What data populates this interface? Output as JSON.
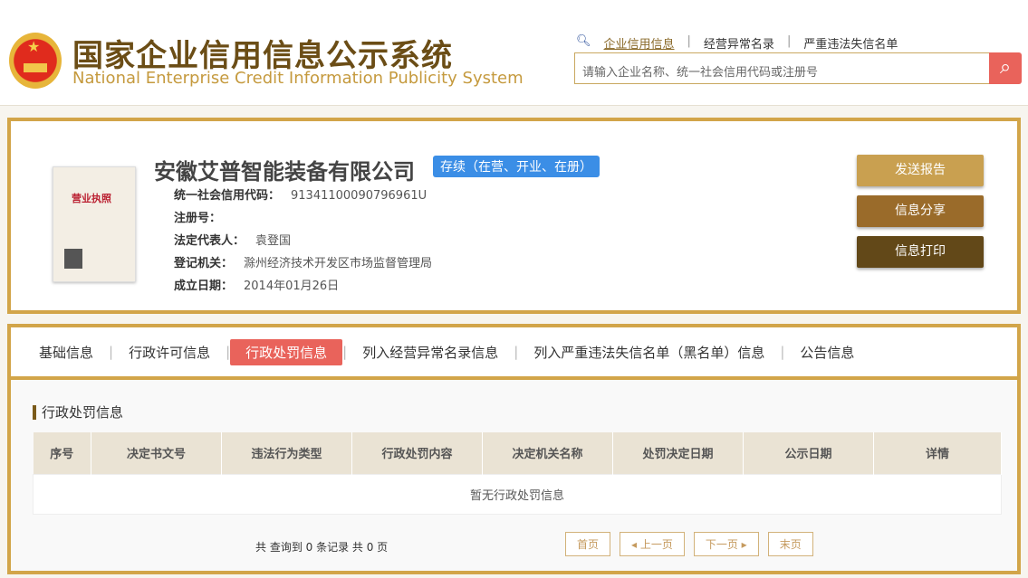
{
  "header": {
    "title_cn": "国家企业信用信息公示系统",
    "title_en": "National Enterprise Credit Information Publicity System",
    "links": [
      "企业信用信息",
      "经营异常名录",
      "严重违法失信名单"
    ],
    "search_placeholder": "请输入企业名称、统一社会信用代码或注册号"
  },
  "company": {
    "license_title": "营业执照",
    "name": "安徽艾普智能装备有限公司",
    "status": "存续（在营、开业、在册）",
    "fields": [
      {
        "label": "统一社会信用代码：",
        "value": "91341100090796961U"
      },
      {
        "label": "注册号：",
        "value": ""
      },
      {
        "label": "法定代表人：",
        "value": "袁登国"
      },
      {
        "label": "登记机关：",
        "value": "滁州经济技术开发区市场监督管理局"
      },
      {
        "label": "成立日期：",
        "value": "2014年01月26日"
      }
    ],
    "buttons": {
      "report": "发送报告",
      "share": "信息分享",
      "print": "信息打印"
    },
    "colors": {
      "report": "#c9a050",
      "share": "#9a6b2a",
      "print": "#624818"
    }
  },
  "tabs": [
    "基础信息",
    "行政许可信息",
    "行政处罚信息",
    "列入经营异常名录信息",
    "列入严重违法失信名单（黑名单）信息",
    "公告信息"
  ],
  "section": {
    "title": "行政处罚信息",
    "columns": [
      "序号",
      "决定书文号",
      "违法行为类型",
      "行政处罚内容",
      "决定机关名称",
      "处罚决定日期",
      "公示日期",
      "详情"
    ],
    "empty": "暂无行政处罚信息",
    "count": "共 查询到 0 条记录 共 0 页",
    "pager": {
      "first": "首页",
      "prev": "◂ 上一页",
      "next": "下一页 ▸",
      "last": "末页"
    }
  }
}
